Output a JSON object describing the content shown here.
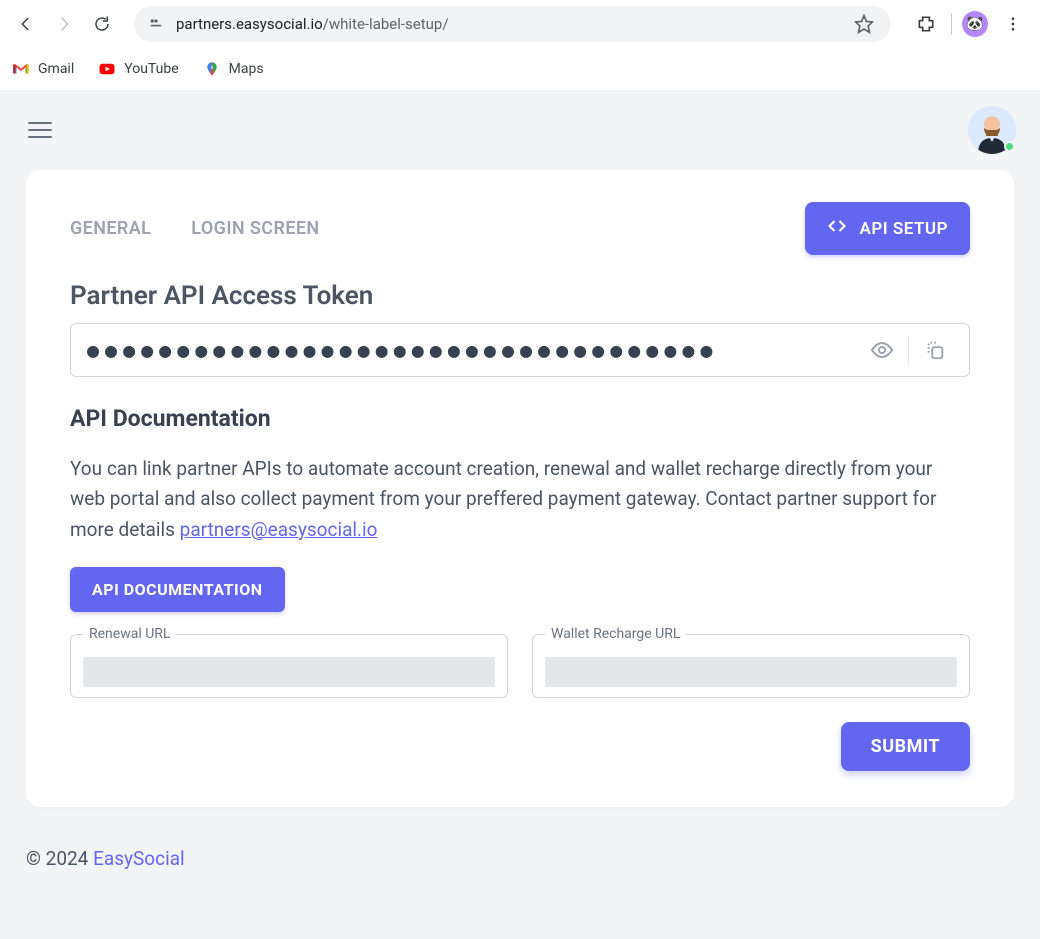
{
  "browser": {
    "url_host": "partners.easysocial.io",
    "url_path": "/white-label-setup/",
    "bookmarks": [
      {
        "label": "Gmail"
      },
      {
        "label": "YouTube"
      },
      {
        "label": "Maps"
      }
    ]
  },
  "tabs": {
    "general": "GENERAL",
    "login_screen": "LOGIN SCREEN",
    "api_setup": "API SETUP"
  },
  "token": {
    "title": "Partner API Access Token",
    "mask": "●●●●●●●●●●●●●●●●●●●●●●●●●●●●●●●●●●●"
  },
  "docs": {
    "title": "API Documentation",
    "body": "You can link partner APIs to automate account creation, renewal and wallet recharge directly from your web portal and also collect payment from your preffered payment gateway. Contact partner support for more details ",
    "email": "partners@easysocial.io",
    "button": "API DOCUMENTATION"
  },
  "fields": {
    "renewal_label": "Renewal URL",
    "wallet_label": "Wallet Recharge URL",
    "renewal_value": "",
    "wallet_value": ""
  },
  "submit_label": "SUBMIT",
  "footer": {
    "copyright": "© 2024 ",
    "brand": "EasySocial"
  }
}
